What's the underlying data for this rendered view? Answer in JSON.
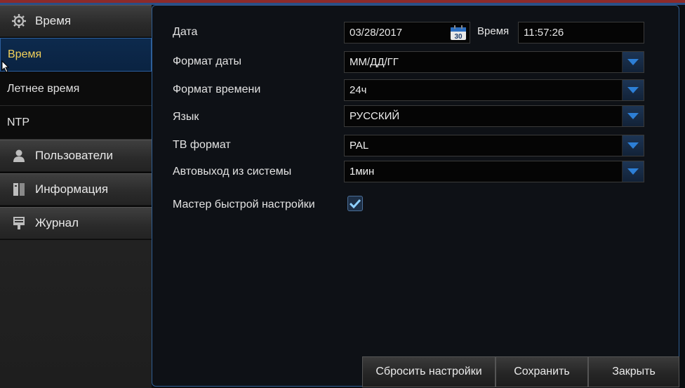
{
  "sidebar": {
    "categories": {
      "time": {
        "label": "Время",
        "icon": "gear-icon"
      },
      "users": {
        "label": "Пользователи",
        "icon": "user-icon"
      },
      "info": {
        "label": "Информация",
        "icon": "info-icon"
      },
      "log": {
        "label": "Журнал",
        "icon": "log-icon"
      }
    },
    "items": [
      {
        "label": "Время",
        "active": true
      },
      {
        "label": "Летнее время",
        "active": false
      },
      {
        "label": "NTP",
        "active": false
      }
    ]
  },
  "form": {
    "date": {
      "label": "Дата",
      "value": "03/28/2017",
      "calendar_day": "30"
    },
    "time": {
      "label": "Время",
      "value": "11:57:26"
    },
    "date_format": {
      "label": "Формат даты",
      "value": "ММ/ДД/ГГ"
    },
    "time_format": {
      "label": "Формат времени",
      "value": "24ч"
    },
    "language": {
      "label": "Язык",
      "value": "РУССКИЙ"
    },
    "tv_format": {
      "label": "ТВ формат",
      "value": "PAL"
    },
    "auto_logout": {
      "label": "Автовыход из системы",
      "value": "1мин"
    },
    "quick_setup": {
      "label": "Мастер быстрой настройки",
      "checked": true
    }
  },
  "buttons": {
    "reset": "Сбросить настройки",
    "save": "Сохранить",
    "close": "Закрыть"
  },
  "colors": {
    "accent_blue": "#2f5e94",
    "active_text": "#f2d15a",
    "dropdown_arrow": "#2d7fd6"
  }
}
